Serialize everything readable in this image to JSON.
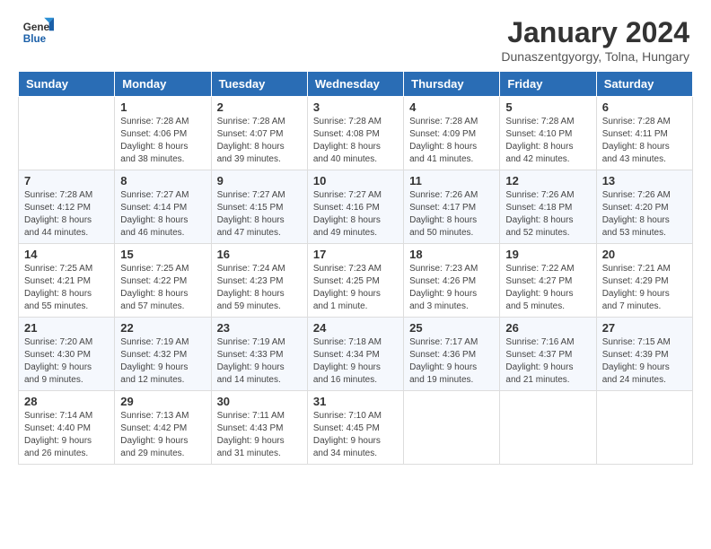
{
  "header": {
    "logo_line1": "General",
    "logo_line2": "Blue",
    "month_title": "January 2024",
    "subtitle": "Dunaszentgyorgy, Tolna, Hungary"
  },
  "weekdays": [
    "Sunday",
    "Monday",
    "Tuesday",
    "Wednesday",
    "Thursday",
    "Friday",
    "Saturday"
  ],
  "weeks": [
    [
      {
        "day": "",
        "info": ""
      },
      {
        "day": "1",
        "info": "Sunrise: 7:28 AM\nSunset: 4:06 PM\nDaylight: 8 hours\nand 38 minutes."
      },
      {
        "day": "2",
        "info": "Sunrise: 7:28 AM\nSunset: 4:07 PM\nDaylight: 8 hours\nand 39 minutes."
      },
      {
        "day": "3",
        "info": "Sunrise: 7:28 AM\nSunset: 4:08 PM\nDaylight: 8 hours\nand 40 minutes."
      },
      {
        "day": "4",
        "info": "Sunrise: 7:28 AM\nSunset: 4:09 PM\nDaylight: 8 hours\nand 41 minutes."
      },
      {
        "day": "5",
        "info": "Sunrise: 7:28 AM\nSunset: 4:10 PM\nDaylight: 8 hours\nand 42 minutes."
      },
      {
        "day": "6",
        "info": "Sunrise: 7:28 AM\nSunset: 4:11 PM\nDaylight: 8 hours\nand 43 minutes."
      }
    ],
    [
      {
        "day": "7",
        "info": "Sunrise: 7:28 AM\nSunset: 4:12 PM\nDaylight: 8 hours\nand 44 minutes."
      },
      {
        "day": "8",
        "info": "Sunrise: 7:27 AM\nSunset: 4:14 PM\nDaylight: 8 hours\nand 46 minutes."
      },
      {
        "day": "9",
        "info": "Sunrise: 7:27 AM\nSunset: 4:15 PM\nDaylight: 8 hours\nand 47 minutes."
      },
      {
        "day": "10",
        "info": "Sunrise: 7:27 AM\nSunset: 4:16 PM\nDaylight: 8 hours\nand 49 minutes."
      },
      {
        "day": "11",
        "info": "Sunrise: 7:26 AM\nSunset: 4:17 PM\nDaylight: 8 hours\nand 50 minutes."
      },
      {
        "day": "12",
        "info": "Sunrise: 7:26 AM\nSunset: 4:18 PM\nDaylight: 8 hours\nand 52 minutes."
      },
      {
        "day": "13",
        "info": "Sunrise: 7:26 AM\nSunset: 4:20 PM\nDaylight: 8 hours\nand 53 minutes."
      }
    ],
    [
      {
        "day": "14",
        "info": "Sunrise: 7:25 AM\nSunset: 4:21 PM\nDaylight: 8 hours\nand 55 minutes."
      },
      {
        "day": "15",
        "info": "Sunrise: 7:25 AM\nSunset: 4:22 PM\nDaylight: 8 hours\nand 57 minutes."
      },
      {
        "day": "16",
        "info": "Sunrise: 7:24 AM\nSunset: 4:23 PM\nDaylight: 8 hours\nand 59 minutes."
      },
      {
        "day": "17",
        "info": "Sunrise: 7:23 AM\nSunset: 4:25 PM\nDaylight: 9 hours\nand 1 minute."
      },
      {
        "day": "18",
        "info": "Sunrise: 7:23 AM\nSunset: 4:26 PM\nDaylight: 9 hours\nand 3 minutes."
      },
      {
        "day": "19",
        "info": "Sunrise: 7:22 AM\nSunset: 4:27 PM\nDaylight: 9 hours\nand 5 minutes."
      },
      {
        "day": "20",
        "info": "Sunrise: 7:21 AM\nSunset: 4:29 PM\nDaylight: 9 hours\nand 7 minutes."
      }
    ],
    [
      {
        "day": "21",
        "info": "Sunrise: 7:20 AM\nSunset: 4:30 PM\nDaylight: 9 hours\nand 9 minutes."
      },
      {
        "day": "22",
        "info": "Sunrise: 7:19 AM\nSunset: 4:32 PM\nDaylight: 9 hours\nand 12 minutes."
      },
      {
        "day": "23",
        "info": "Sunrise: 7:19 AM\nSunset: 4:33 PM\nDaylight: 9 hours\nand 14 minutes."
      },
      {
        "day": "24",
        "info": "Sunrise: 7:18 AM\nSunset: 4:34 PM\nDaylight: 9 hours\nand 16 minutes."
      },
      {
        "day": "25",
        "info": "Sunrise: 7:17 AM\nSunset: 4:36 PM\nDaylight: 9 hours\nand 19 minutes."
      },
      {
        "day": "26",
        "info": "Sunrise: 7:16 AM\nSunset: 4:37 PM\nDaylight: 9 hours\nand 21 minutes."
      },
      {
        "day": "27",
        "info": "Sunrise: 7:15 AM\nSunset: 4:39 PM\nDaylight: 9 hours\nand 24 minutes."
      }
    ],
    [
      {
        "day": "28",
        "info": "Sunrise: 7:14 AM\nSunset: 4:40 PM\nDaylight: 9 hours\nand 26 minutes."
      },
      {
        "day": "29",
        "info": "Sunrise: 7:13 AM\nSunset: 4:42 PM\nDaylight: 9 hours\nand 29 minutes."
      },
      {
        "day": "30",
        "info": "Sunrise: 7:11 AM\nSunset: 4:43 PM\nDaylight: 9 hours\nand 31 minutes."
      },
      {
        "day": "31",
        "info": "Sunrise: 7:10 AM\nSunset: 4:45 PM\nDaylight: 9 hours\nand 34 minutes."
      },
      {
        "day": "",
        "info": ""
      },
      {
        "day": "",
        "info": ""
      },
      {
        "day": "",
        "info": ""
      }
    ]
  ]
}
